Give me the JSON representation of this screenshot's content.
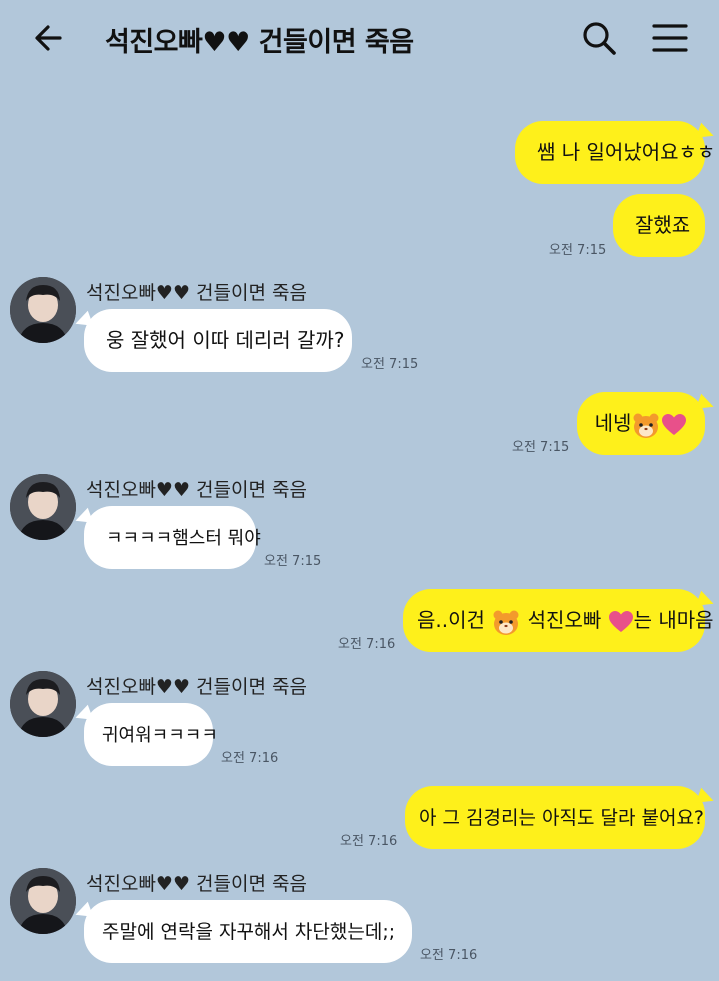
{
  "header": {
    "title": "석진오빠♥♥ 건들이면 죽음"
  },
  "messages": [
    {
      "type": "sent",
      "text": "쌤 나 일어났어요ㅎㅎ"
    },
    {
      "type": "sent",
      "text": "잘했죠",
      "time": "오전 7:15"
    },
    {
      "type": "recv",
      "sender": "석진오빠♥♥ 건들이면 죽음",
      "text": "웅 잘했어 이따 데리러 갈까?",
      "time": "오전 7:15"
    },
    {
      "type": "sent",
      "text": "네넹",
      "emojis": [
        "hamster-emoji",
        "heart-emoji"
      ],
      "time": "오전 7:15"
    },
    {
      "type": "recv",
      "sender": "석진오빠♥♥ 건들이면 죽음",
      "text": "ㅋㅋㅋㅋ햄스터 뭐야",
      "time": "오전 7:15"
    },
    {
      "type": "sent",
      "text_a": "음..이건",
      "text_b": "석진오빠",
      "text_c": "는 내마음",
      "emojis": [
        "hamster-emoji",
        "heart-emoji"
      ],
      "time": "오전 7:16"
    },
    {
      "type": "recv",
      "sender": "석진오빠♥♥ 건들이면 죽음",
      "text": "귀여워ㅋㅋㅋㅋ",
      "time": "오전 7:16"
    },
    {
      "type": "sent",
      "text": "아 그 김경리는 아직도 달라 붙어요?",
      "time": "오전 7:16"
    },
    {
      "type": "recv",
      "sender": "석진오빠♥♥ 건들이면 죽음",
      "text": "주말에 연락을 자꾸해서 차단했는데;;",
      "time": "오전 7:16"
    }
  ],
  "colors": {
    "background": "#b2c7da",
    "sent_bubble": "#fef01b",
    "recv_bubble": "#ffffff",
    "heart": "#e8508a",
    "hamster": "#f39a2c"
  },
  "icons": [
    "back-arrow-icon",
    "search-icon",
    "menu-icon"
  ]
}
